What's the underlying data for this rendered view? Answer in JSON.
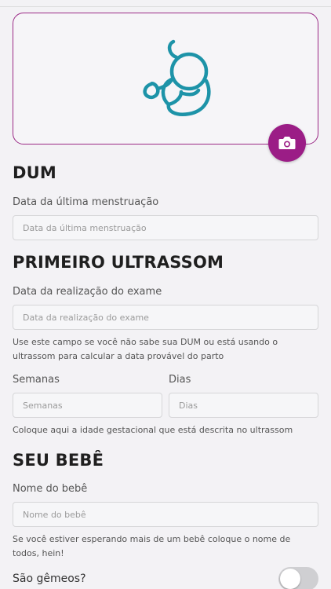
{
  "photo": {
    "icon": "fetus-icon",
    "camera_icon": "camera-icon",
    "accent_color": "#9b1d86",
    "icon_color": "#1d93a8"
  },
  "dum": {
    "title": "DUM",
    "label": "Data da última menstruação",
    "placeholder": "Data da última menstruação"
  },
  "ultrasound": {
    "title": "PRIMEIRO ULTRASSOM",
    "date_label": "Data da realização do exame",
    "date_placeholder": "Data da realização do exame",
    "date_help": "Use este campo se você não sabe sua DUM ou está usando o ultrassom para calcular a data provável do parto",
    "weeks_label": "Semanas",
    "weeks_placeholder": "Semanas",
    "days_label": "Dias",
    "days_placeholder": "Dias",
    "age_help": "Coloque aqui a idade gestacional que está descrita no ultrassom"
  },
  "baby": {
    "title": "SEU BEBÊ",
    "name_label": "Nome do bebê",
    "name_placeholder": "Nome do bebê",
    "name_help": "Se você estiver esperando mais de um bebê coloque o nome de todos, hein!",
    "twins_label": "São gêmeos?",
    "twins_on": false
  }
}
